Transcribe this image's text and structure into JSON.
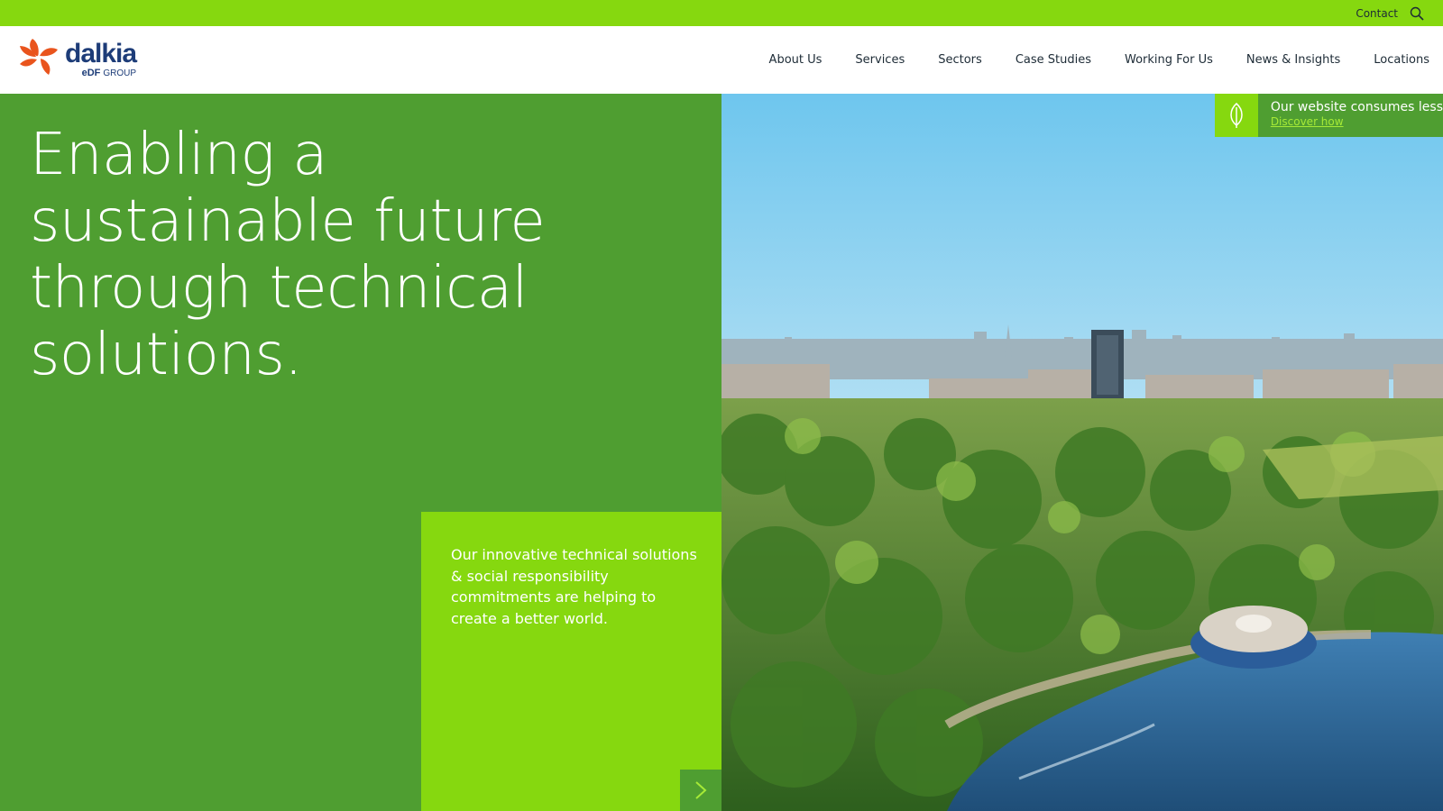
{
  "topbar": {
    "contact_label": "Contact",
    "search_icon": "search-icon"
  },
  "header": {
    "logo": {
      "brand": "dalkia",
      "group_prefix": "eDF",
      "group_suffix": "GROUP",
      "icon": "dalkia-petal-logo"
    },
    "nav": [
      {
        "label": "About Us"
      },
      {
        "label": "Services"
      },
      {
        "label": "Sectors"
      },
      {
        "label": "Case Studies"
      },
      {
        "label": "Working For Us"
      },
      {
        "label": "News & Insights"
      },
      {
        "label": "Locations"
      }
    ]
  },
  "hero": {
    "title_lines": [
      "Enabling a",
      "sustainable future",
      "through technical",
      "solutions."
    ],
    "promo_text": "Our innovative technical solutions & social responsibility commitments are helping to create a better world.",
    "promo_arrow_icon": "chevron-right-icon",
    "image_icon": "aerial-city-park-photo"
  },
  "eco_banner": {
    "line1": "Our website consumes less",
    "link": "Discover how",
    "icon": "leaf-icon"
  },
  "colors": {
    "lime": "#86d80f",
    "green": "#4f9e31",
    "navy": "#1d3c78",
    "orange": "#e9541d",
    "text_dark": "#1d2b36"
  }
}
